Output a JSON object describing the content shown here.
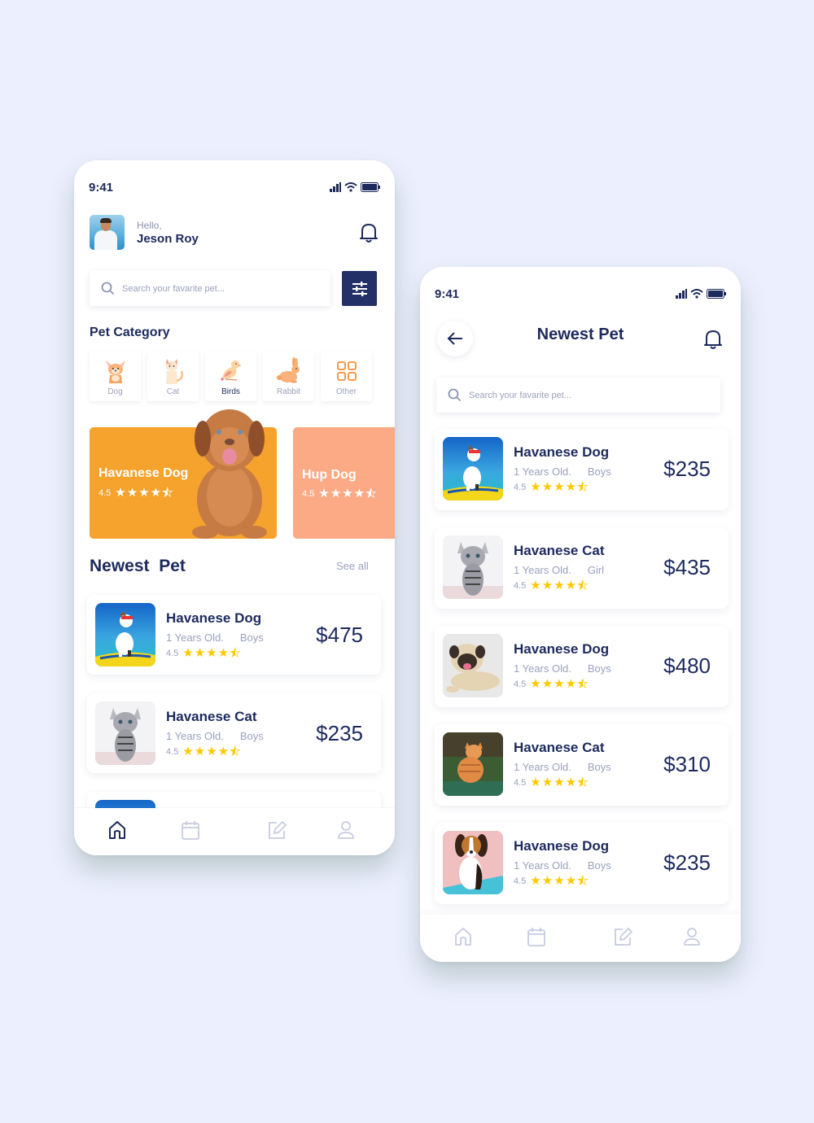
{
  "colors": {
    "background": "#ebeffe",
    "primary": "#1d2a5c",
    "filter_button": "#232f67",
    "muted": "#9aa1bd",
    "star": "#ffc800",
    "featured_orange": "#f5a32c",
    "featured_peach": "#fbaa85"
  },
  "home": {
    "status": {
      "time": "9:41",
      "icons": [
        "signal-icon",
        "wifi-icon",
        "battery-icon"
      ]
    },
    "greeting": {
      "hello": "Hello,",
      "name": "Jeson Roy"
    },
    "search": {
      "placeholder": "Search your favarite pet..."
    },
    "category_title": "Pet Category",
    "categories": [
      {
        "label": "Dog",
        "icon": "dog-icon",
        "active": false
      },
      {
        "label": "Cat",
        "icon": "cat-icon",
        "active": false
      },
      {
        "label": "Birds",
        "icon": "bird-icon",
        "active": true
      },
      {
        "label": "Rabbit",
        "icon": "rabbit-icon",
        "active": false
      },
      {
        "label": "Other",
        "icon": "grid-icon",
        "active": false
      }
    ],
    "featured": [
      {
        "name": "Havanese Dog",
        "rating": "4.5",
        "stars": 4.5
      },
      {
        "name": "Hup Dog",
        "rating": "4.5",
        "stars": 4.5
      }
    ],
    "newest_title": "Newest  Pet",
    "see_all": "See all",
    "pets": [
      {
        "name": "Havanese Dog",
        "age": "1 Years Old.",
        "gender": "Boys",
        "rating": "4.5",
        "stars": 4.5,
        "price": "$475",
        "image": "dog-surfboard"
      },
      {
        "name": "Havanese Cat",
        "age": "1 Years Old.",
        "gender": "Boys",
        "rating": "4.5",
        "stars": 4.5,
        "price": "$235",
        "image": "tabby-kitten"
      }
    ],
    "nav": [
      {
        "icon": "home-icon",
        "active": true
      },
      {
        "icon": "calendar-icon",
        "active": false
      },
      {
        "icon": "edit-icon",
        "active": false
      },
      {
        "icon": "profile-icon",
        "active": false
      }
    ]
  },
  "newest": {
    "status": {
      "time": "9:41"
    },
    "title": "Newest Pet",
    "search": {
      "placeholder": "Search your favarite pet..."
    },
    "pets": [
      {
        "name": "Havanese Dog",
        "age": "1 Years Old.",
        "gender": "Boys",
        "rating": "4.5",
        "stars": 4.5,
        "price": "$235",
        "image": "dog-surfboard"
      },
      {
        "name": "Havanese Cat",
        "age": "1 Years Old.",
        "gender": "Girl",
        "rating": "4.5",
        "stars": 4.5,
        "price": "$435",
        "image": "tabby-kitten"
      },
      {
        "name": "Havanese Dog",
        "age": "1 Years Old.",
        "gender": "Boys",
        "rating": "4.5",
        "stars": 4.5,
        "price": "$480",
        "image": "pug"
      },
      {
        "name": "Havanese Cat",
        "age": "1 Years Old.",
        "gender": "Boys",
        "rating": "4.5",
        "stars": 4.5,
        "price": "$310",
        "image": "orange-cat"
      },
      {
        "name": "Havanese Dog",
        "age": "1 Years Old.",
        "gender": "Boys",
        "rating": "4.5",
        "stars": 4.5,
        "price": "$235",
        "image": "beagle-puppy"
      }
    ]
  }
}
